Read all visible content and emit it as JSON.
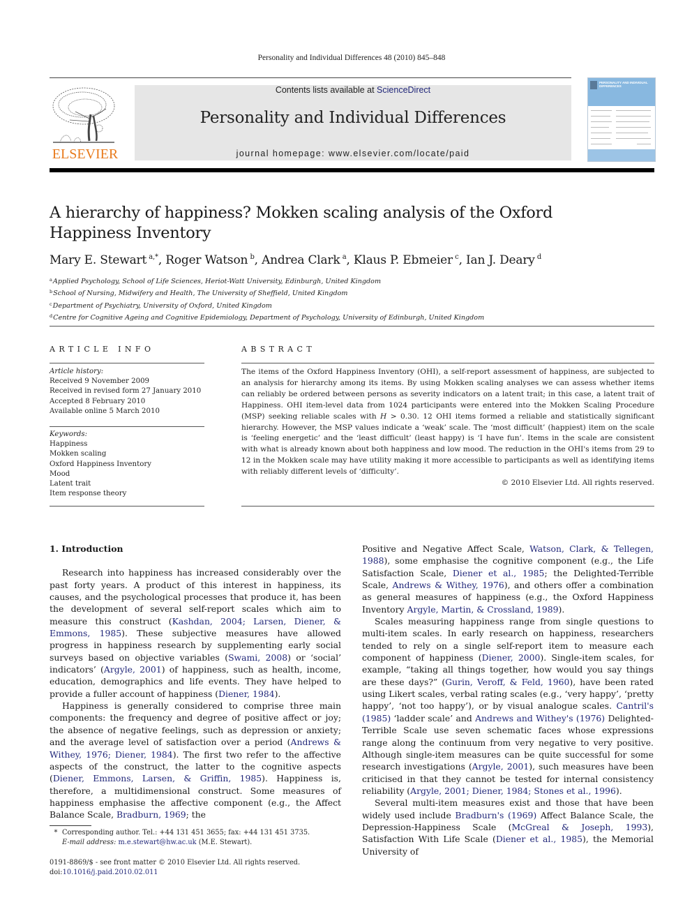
{
  "running_head": "Personality and Individual Differences 48 (2010) 845–848",
  "masthead": {
    "publisher_logo_text": "ELSEVIER",
    "contents_prefix": "Contents lists available at ",
    "contents_link": "ScienceDirect",
    "journal_title": "Personality and Individual Differences",
    "homepage": "journal homepage: www.elsevier.com/locate/paid",
    "cover_title": "PERSONALITY AND INDIVIDUAL DIFFERENCES",
    "colors": {
      "logo_orange": "#e87a1c",
      "banner_gray": "#e6e6e6",
      "link_blue": "#22287a",
      "cover_blue": "#88b8e0"
    }
  },
  "article": {
    "title": "A hierarchy of happiness? Mokken scaling analysis of the Oxford Happiness Inventory",
    "authors": [
      {
        "name": "Mary E. Stewart",
        "sup": "a,*",
        "sep": ", "
      },
      {
        "name": "Roger Watson",
        "sup": "b",
        "sep": ", "
      },
      {
        "name": "Andrea Clark",
        "sup": "a",
        "sep": ", "
      },
      {
        "name": "Klaus P. Ebmeier",
        "sup": "c",
        "sep": ", "
      },
      {
        "name": "Ian J. Deary",
        "sup": "d",
        "sep": ""
      }
    ],
    "affiliations": [
      {
        "mark": "a",
        "text": "Applied Psychology, School of Life Sciences, Heriot-Watt University, Edinburgh, United Kingdom"
      },
      {
        "mark": "b",
        "text": "School of Nursing, Midwifery and Health, The University of Sheffield, United Kingdom"
      },
      {
        "mark": "c",
        "text": "Department of Psychiatry, University of Oxford, United Kingdom"
      },
      {
        "mark": "d",
        "text": "Centre for Cognitive Ageing and Cognitive Epidemiology, Department of Psychology, University of Edinburgh, United Kingdom"
      }
    ]
  },
  "article_info": {
    "heading": "ARTICLE INFO",
    "history_label": "Article history:",
    "history": [
      "Received 9 November 2009",
      "Received in revised form 27 January 2010",
      "Accepted 8 February 2010",
      "Available online 5 March 2010"
    ],
    "keywords_label": "Keywords:",
    "keywords": [
      "Happiness",
      "Mokken scaling",
      "Oxford Happiness Inventory",
      "Mood",
      "Latent trait",
      "Item response theory"
    ]
  },
  "abstract": {
    "heading": "ABSTRACT",
    "text_1": "The items of the Oxford Happiness Inventory (OHI), a self-report assessment of happiness, are subjected to an analysis for hierarchy among its items. By using Mokken scaling analyses we can assess whether items can reliably be ordered between persons as severity indicators on a latent trait; in this case, a latent trait of Happiness. OHI item-level data from 1024 participants were entered into the Mokken Scaling Procedure (MSP) seeking reliable scales with ",
    "text_H": "H",
    "text_2": " > 0.30. 12 OHI items formed a reliable and statistically significant hierarchy. However, the MSP values indicate a ‘weak’ scale. The ‘most difficult’ (happiest) item on the scale is ‘feeling energetic’ and the ‘least difficult’ (least happy) is ‘I have fun’. Items in the scale are consistent with what is already known about both happiness and low mood. The reduction in the OHI's items from 29 to 12 in the Mokken scale may have utility making it more accessible to participants as well as identifying items with reliably different levels of ‘difficulty’.",
    "copyright": "© 2010 Elsevier Ltd. All rights reserved."
  },
  "body": {
    "section_title": "1. Introduction",
    "p1": [
      {
        "t": "Research into happiness has increased considerably over the past forty years. A product of this interest in happiness, its causes, and the psychological processes that produce it, has been the development of several self-report scales which aim to measure this construct ("
      },
      {
        "l": "Kashdan, 2004; Larsen, Diener, & Emmons, 1985"
      },
      {
        "t": "). These subjective measures have allowed progress in happiness research by supplementing early social surveys based on objective variables ("
      },
      {
        "l": "Swami, 2008"
      },
      {
        "t": ") or ‘social’ indicators’ ("
      },
      {
        "l": "Argyle, 2001"
      },
      {
        "t": ") of happiness, such as health, income, education, demographics and life events. They have helped to provide a fuller account of happiness ("
      },
      {
        "l": "Diener, 1984"
      },
      {
        "t": ")."
      }
    ],
    "p2": [
      {
        "t": "Happiness is generally considered to comprise three main components: the frequency and degree of positive affect or joy; the absence of negative feelings, such as depression or anxiety; and the average level of satisfaction over a period ("
      },
      {
        "l": "Andrews & Withey, 1976; Diener, 1984"
      },
      {
        "t": "). The first two refer to the affective aspects of the construct, the latter to the cognitive aspects ("
      },
      {
        "l": "Diener, Emmons, Larsen, & Griffin, 1985"
      },
      {
        "t": "). Happiness is, therefore, a multidimensional construct. Some measures of happiness emphasise the affective component (e.g., the Affect Balance Scale, "
      },
      {
        "l": "Bradburn, 1969"
      },
      {
        "t": "; the "
      }
    ],
    "p2_cont": [
      {
        "t": "Positive and Negative Affect Scale, "
      },
      {
        "l": "Watson, Clark, & Tellegen, 1988"
      },
      {
        "t": "), some emphasise the cognitive component (e.g., the Life Satisfaction Scale, "
      },
      {
        "l": "Diener et al., 1985"
      },
      {
        "t": "; the Delighted-Terrible Scale, "
      },
      {
        "l": "Andrews & Withey, 1976"
      },
      {
        "t": "), and others offer a combination as general measures of happiness (e.g., the Oxford Happiness Inventory "
      },
      {
        "l": "Argyle, Martin, & Crossland, 1989"
      },
      {
        "t": ")."
      }
    ],
    "p3": [
      {
        "t": "Scales measuring happiness range from single questions to multi-item scales. In early research on happiness, researchers tended to rely on a single self-report item to measure each component of happiness ("
      },
      {
        "l": "Diener, 2000"
      },
      {
        "t": "). Single-item scales, for example, “taking all things together, how would you say things are these days?” ("
      },
      {
        "l": "Gurin, Veroff, & Feld, 1960"
      },
      {
        "t": "), have been rated using Likert scales, verbal rating scales (e.g., ‘very happy’, ‘pretty happy’, ‘not too happy’), or by visual analogue scales. "
      },
      {
        "l": "Cantril's (1985)"
      },
      {
        "t": " ‘ladder scale’ and "
      },
      {
        "l": "Andrews and Withey's (1976)"
      },
      {
        "t": " Delighted-Terrible Scale use seven schematic faces whose expressions range along the continuum from very negative to very positive. Although single-item measures can be quite successful for some research investigations ("
      },
      {
        "l": "Argyle, 2001"
      },
      {
        "t": "), such measures have been criticised in that they cannot be tested for internal consistency reliability ("
      },
      {
        "l": "Argyle, 2001; Diener, 1984; Stones et al., 1996"
      },
      {
        "t": ")."
      }
    ],
    "p4": [
      {
        "t": "Several multi-item measures exist and those that have been widely used include "
      },
      {
        "l": "Bradburn's (1969)"
      },
      {
        "t": " Affect Balance Scale, the Depression-Happiness Scale ("
      },
      {
        "l": "McGreal & Joseph, 1993"
      },
      {
        "t": "), Satisfaction With Life Scale ("
      },
      {
        "l": "Diener et al., 1985"
      },
      {
        "t": "), the Memorial University of"
      }
    ]
  },
  "footnote": {
    "star": "*",
    "corresponding": "Corresponding author. Tel.: +44 131 451 3655; fax: +44 131 451 3735.",
    "email_label": "E-mail address:",
    "email": "m.e.stewart@hw.ac.uk",
    "email_suffix": " (M.E. Stewart)."
  },
  "front_matter": {
    "issn_line": "0191-8869/$ - see front matter © 2010 Elsevier Ltd. All rights reserved.",
    "doi_prefix": "doi:",
    "doi": "10.1016/j.paid.2010.02.011"
  }
}
